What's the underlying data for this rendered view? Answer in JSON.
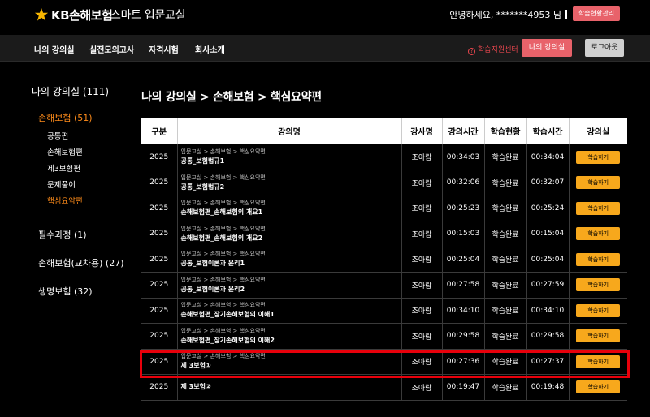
{
  "header": {
    "brand": "KB손해보험",
    "app_title": "스마트 입문교실",
    "greeting": "안녕하세요, *******4953 님",
    "manage_button": "학습현황관리"
  },
  "nav": {
    "items": [
      "나의 강의실",
      "실전모의고사",
      "자격시험",
      "회사소개"
    ],
    "support": "학습지원센터",
    "my_class_button": "나의 강의실",
    "logout_button": "로그아웃"
  },
  "sidebar": {
    "title": "나의 강의실 (111)",
    "active_category": "손해보험 (51)",
    "subitems": [
      "공통편",
      "손해보험편",
      "제3보험편",
      "문제풀이",
      "핵심요약편"
    ],
    "active_sub": "핵심요약편",
    "categories": [
      "필수과정 (1)",
      "손해보험(교차용) (27)",
      "생명보험 (32)"
    ]
  },
  "page_heading": "나의 강의실 > 손해보험 > 핵심요약편",
  "table": {
    "headers": [
      "구분",
      "강의명",
      "강사명",
      "강의시간",
      "학습현황",
      "학습시간",
      "강의실"
    ],
    "rows": [
      {
        "year": "2025",
        "crumb": "입문교실 > 손해보험 > 핵심요약편",
        "name": "공통_보험법규1",
        "teacher": "조아람",
        "duration": "00:34:03",
        "status": "학습완료",
        "studied": "00:34:04",
        "button": "학습하기"
      },
      {
        "year": "2025",
        "crumb": "입문교실 > 손해보험 > 핵심요약편",
        "name": "공통_보험법규2",
        "teacher": "조아람",
        "duration": "00:32:06",
        "status": "학습완료",
        "studied": "00:32:07",
        "button": "학습하기"
      },
      {
        "year": "2025",
        "crumb": "입문교실 > 손해보험 > 핵심요약편",
        "name": "손해보험편_손해보험의 개요1",
        "teacher": "조아람",
        "duration": "00:25:23",
        "status": "학습완료",
        "studied": "00:25:24",
        "button": "학습하기"
      },
      {
        "year": "2025",
        "crumb": "입문교실 > 손해보험 > 핵심요약편",
        "name": "손해보험편_손해보험의 개요2",
        "teacher": "조아람",
        "duration": "00:15:03",
        "status": "학습완료",
        "studied": "00:15:04",
        "button": "학습하기"
      },
      {
        "year": "2025",
        "crumb": "입문교실 > 손해보험 > 핵심요약편",
        "name": "공통_보험이론과 윤리1",
        "teacher": "조아람",
        "duration": "00:25:04",
        "status": "학습완료",
        "studied": "00:25:04",
        "button": "학습하기"
      },
      {
        "year": "2025",
        "crumb": "입문교실 > 손해보험 > 핵심요약편",
        "name": "공통_보험이론과 윤리2",
        "teacher": "조아람",
        "duration": "00:27:58",
        "status": "학습완료",
        "studied": "00:27:59",
        "button": "학습하기"
      },
      {
        "year": "2025",
        "crumb": "입문교실 > 손해보험 > 핵심요약편",
        "name": "손해보험편_장기손해보험의 이해1",
        "teacher": "조아람",
        "duration": "00:34:10",
        "status": "학습완료",
        "studied": "00:34:10",
        "button": "학습하기"
      },
      {
        "year": "2025",
        "crumb": "입문교실 > 손해보험 > 핵심요약편",
        "name": "손해보험편_장기손해보험의 이해2",
        "teacher": "조아람",
        "duration": "00:29:58",
        "status": "학습완료",
        "studied": "00:29:58",
        "button": "학습하기"
      },
      {
        "year": "2025",
        "crumb": "입문교실 > 손해보험 > 핵심요약편",
        "name": "제 3보험①",
        "teacher": "조아람",
        "duration": "00:27:36",
        "status": "학습완료",
        "studied": "00:27:37",
        "button": "학습하기"
      },
      {
        "year": "2025",
        "crumb": "",
        "name": "제 3보험②",
        "teacher": "조아람",
        "duration": "00:19:47",
        "status": "학습완료",
        "studied": "00:19:48",
        "button": "학습하기"
      }
    ]
  },
  "colors": {
    "accent_orange": "#ff8c1a",
    "button_yellow": "#f7a81c",
    "status_purple": "#9b8cff",
    "pink_button": "#e8626a",
    "highlight_red": "#e8000b"
  }
}
